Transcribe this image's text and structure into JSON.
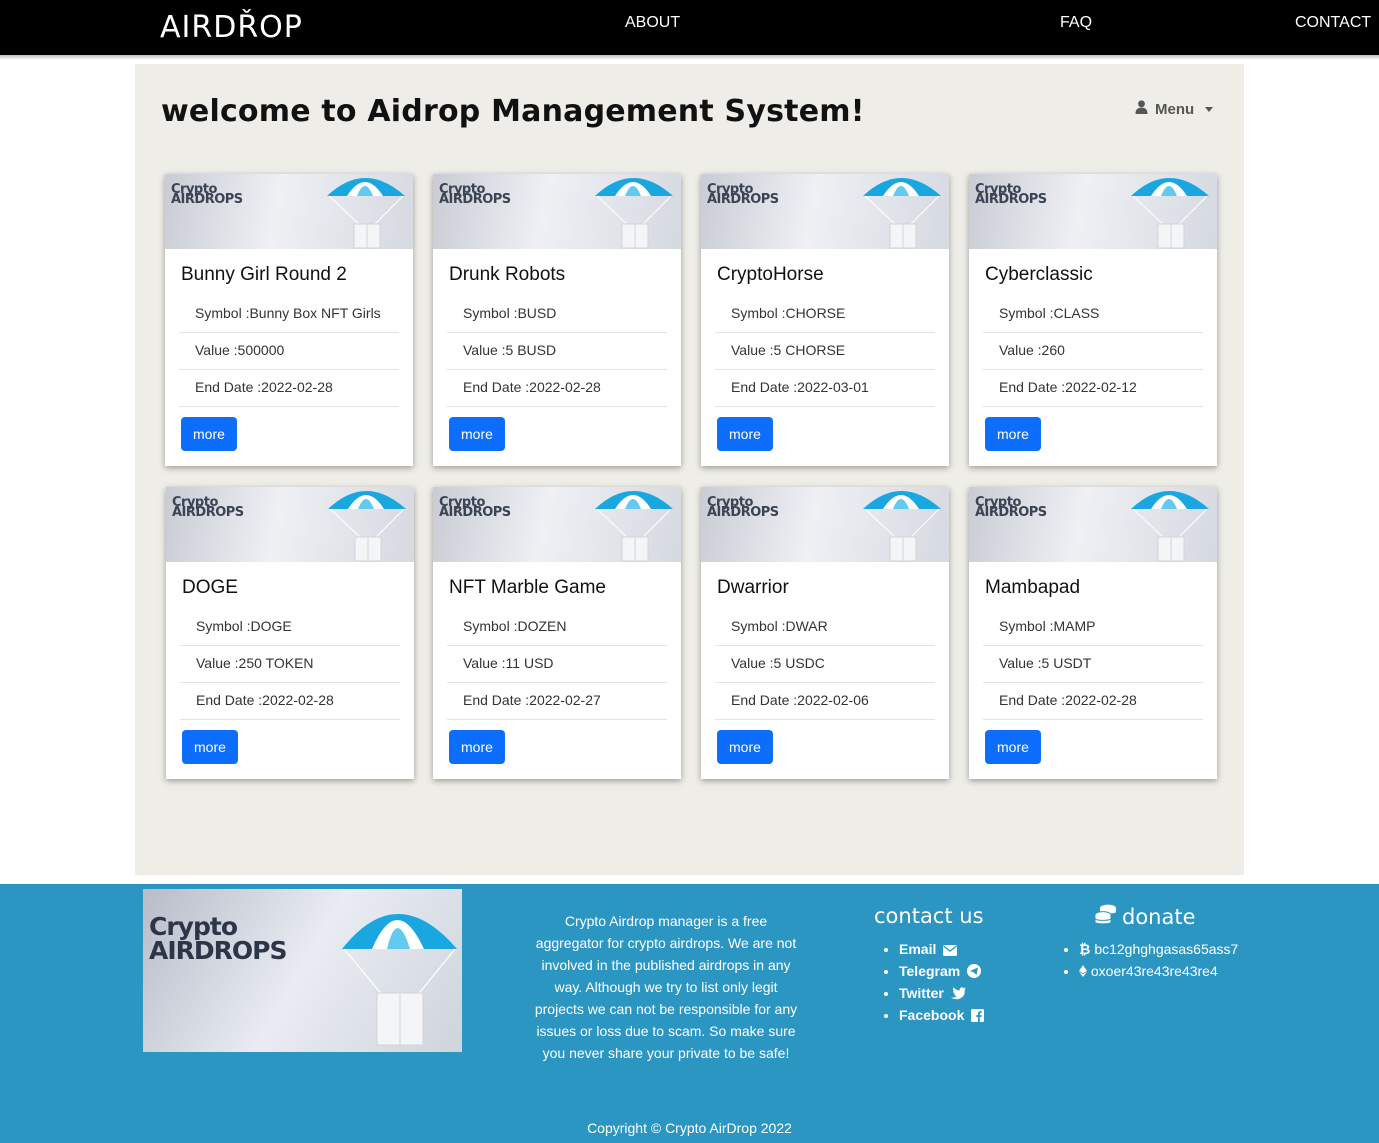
{
  "navbar": {
    "brand": "AIRDŘOP",
    "links": [
      "ABOUT",
      "FAQ",
      "CONTACT"
    ]
  },
  "main": {
    "title": "welcome to Aidrop Management System!",
    "menu_label": "Menu"
  },
  "card_image": {
    "line1": "Crypto",
    "line2": "AIRDROPS"
  },
  "cards": [
    {
      "name": "Bunny Girl Round 2",
      "symbol": "Symbol :Bunny Box NFT Girls",
      "value": "Value :500000",
      "end_date": "End Date :2022-02-28",
      "button": "more"
    },
    {
      "name": "Drunk Robots",
      "symbol": "Symbol :BUSD",
      "value": "Value :5 BUSD",
      "end_date": "End Date :2022-02-28",
      "button": "more"
    },
    {
      "name": "CryptoHorse",
      "symbol": "Symbol :CHORSE",
      "value": "Value :5 CHORSE",
      "end_date": "End Date :2022-03-01",
      "button": "more"
    },
    {
      "name": "Cyberclassic",
      "symbol": "Symbol :CLASS",
      "value": "Value :260",
      "end_date": "End Date :2022-02-12",
      "button": "more"
    },
    {
      "name": "DOGE",
      "symbol": "Symbol :DOGE",
      "value": "Value :250 TOKEN",
      "end_date": "End Date :2022-02-28",
      "button": "more"
    },
    {
      "name": "NFT Marble Game",
      "symbol": "Symbol :DOZEN",
      "value": "Value :11 USD",
      "end_date": "End Date :2022-02-27",
      "button": "more"
    },
    {
      "name": "Dwarrior",
      "symbol": "Symbol :DWAR",
      "value": "Value :5 USDC",
      "end_date": "End Date :2022-02-06",
      "button": "more"
    },
    {
      "name": "Mambapad",
      "symbol": "Symbol :MAMP",
      "value": "Value :5 USDT",
      "end_date": "End Date :2022-02-28",
      "button": "more"
    }
  ],
  "footer": {
    "logo_line1": "Crypto",
    "logo_line2": "AIRDROPS",
    "about": "Crypto Airdrop manager is a free aggregator for crypto airdrops. We are not involved in the published airdrops in any way. Although we try to list only legit projects we can not be responsible for any issues or loss due to scam. So make sure you never share your private to be safe!",
    "contact_title": "contact us",
    "contact_items": [
      {
        "label": "Email",
        "icon": "envelope-icon"
      },
      {
        "label": "Telegram",
        "icon": "telegram-icon"
      },
      {
        "label": "Twitter",
        "icon": "twitter-icon"
      },
      {
        "label": "Facebook",
        "icon": "facebook-icon"
      }
    ],
    "donate_title": "donate",
    "donate_items": [
      {
        "address": "bc12ghghgasas65ass7",
        "icon": "bitcoin-icon"
      },
      {
        "address": "oxoer43re43re43re4",
        "icon": "ethereum-icon"
      }
    ],
    "copyright": "Copyright © Crypto AirDrop 2022"
  },
  "colors": {
    "navbar_bg": "#000000",
    "panel_bg": "#eeede7",
    "button_bg": "#0d6efd",
    "footer_bg": "#2b96c2"
  }
}
